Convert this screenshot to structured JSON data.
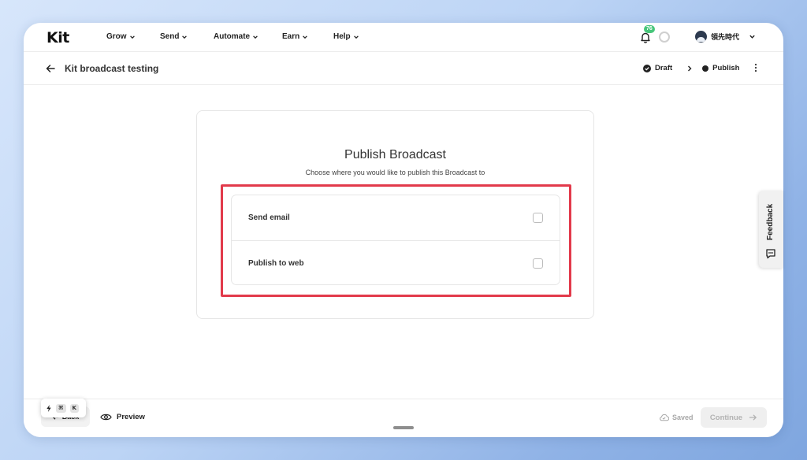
{
  "brand": {
    "logo_text": "Kit"
  },
  "topnav": {
    "items": [
      {
        "label": "Grow"
      },
      {
        "label": "Send"
      },
      {
        "label": "Automate"
      },
      {
        "label": "Earn"
      },
      {
        "label": "Help"
      }
    ],
    "notification_count": "76",
    "account_name": "領先時代"
  },
  "subheader": {
    "title": "Kit broadcast testing",
    "steps": [
      {
        "label": "Draft",
        "state": "completed"
      },
      {
        "label": "Publish",
        "state": "current"
      }
    ]
  },
  "publish_card": {
    "title": "Publish Broadcast",
    "subtitle": "Choose where you would like to publish this Broadcast to",
    "options": [
      {
        "label": "Send email",
        "checked": false
      },
      {
        "label": "Publish to web",
        "checked": false
      }
    ],
    "highlight_color": "#e23a4b"
  },
  "footer": {
    "back_label": "Back",
    "shortcut_keys": [
      "⌘",
      "K"
    ],
    "preview_label": "Preview",
    "saved_label": "Saved",
    "continue_label": "Continue"
  },
  "feedback": {
    "label": "Feedback"
  },
  "colors": {
    "accent_green": "#47c67a",
    "text_dark": "#222222",
    "disabled_text": "#b2b2b2"
  }
}
